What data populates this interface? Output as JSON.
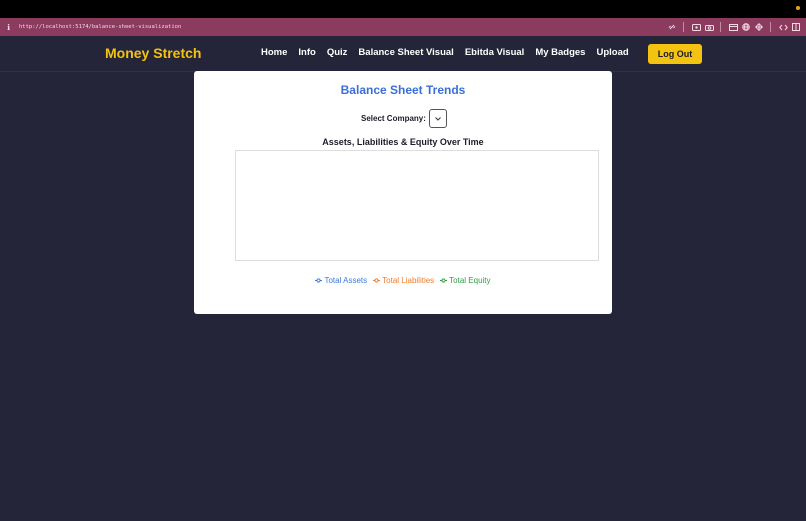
{
  "browser": {
    "url": "http://localhost:5174/balance-sheet-visualization"
  },
  "nav": {
    "brand": "Money Stretch",
    "links": [
      "Home",
      "Info",
      "Quiz",
      "Balance Sheet Visual",
      "Ebitda Visual",
      "My Badges",
      "Upload"
    ],
    "logout_label": "Log Out"
  },
  "card": {
    "title": "Balance Sheet Trends",
    "select_label": "Select Company:",
    "select_value": "",
    "chart_title": "Assets, Liabilities & Equity Over Time"
  },
  "chart_data": {
    "type": "line",
    "title": "Assets, Liabilities & Equity Over Time",
    "x": [],
    "series": [
      {
        "name": "Total Assets",
        "color": "#3a7bd5",
        "values": []
      },
      {
        "name": "Total Liabilities",
        "color": "#f07c2a",
        "values": []
      },
      {
        "name": "Total Equity",
        "color": "#2f9e44",
        "values": []
      }
    ],
    "legend": "bottom"
  },
  "colors": {
    "accent": "#f4c211",
    "title_blue": "#3a6fd8",
    "background": "#25253a"
  }
}
